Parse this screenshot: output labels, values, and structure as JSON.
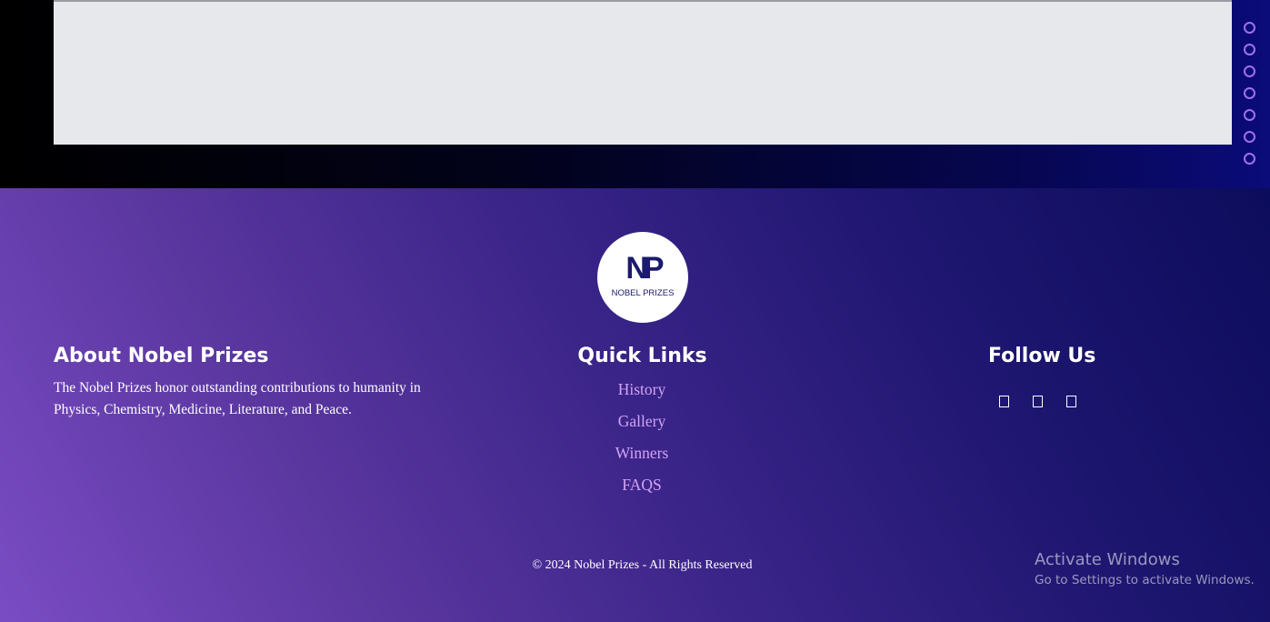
{
  "logo": {
    "mark": "NP",
    "text": "NOBEL PRIZES"
  },
  "dot_nav": {
    "count": 7
  },
  "about": {
    "title": "About Nobel Prizes",
    "text": "The Nobel Prizes honor outstanding contributions to humanity in Physics, Chemistry, Medicine, Literature, and Peace."
  },
  "quick_links": {
    "title": "Quick Links",
    "items": [
      {
        "label": "History"
      },
      {
        "label": "Gallery"
      },
      {
        "label": "Winners"
      },
      {
        "label": "FAQS"
      }
    ]
  },
  "follow": {
    "title": "Follow Us",
    "icons": [
      "social-icon-1",
      "social-icon-2",
      "social-icon-3"
    ]
  },
  "copyright": "© 2024 Nobel Prizes - All Rights Reserved",
  "activate_windows": {
    "title": "Activate Windows",
    "subtitle": "Go to Settings to activate Windows."
  },
  "colors": {
    "link": "#d2a4f5",
    "dot": "#a070e8",
    "logo_text": "#1c1a6e"
  }
}
